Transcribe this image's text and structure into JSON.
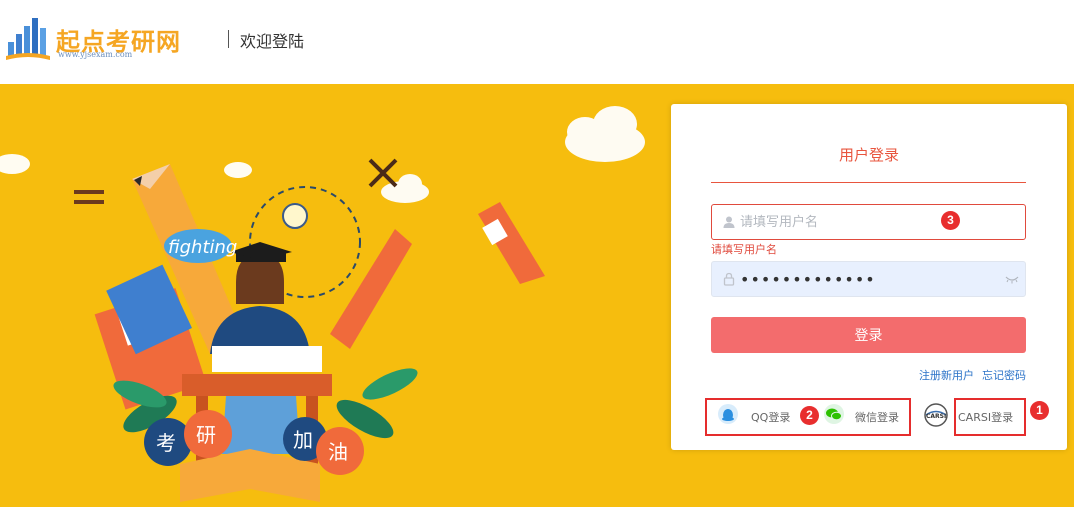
{
  "header": {
    "logo_text": "起点考研网",
    "logo_url": "www.yjsexam.com",
    "title": "欢迎登陆"
  },
  "illustration": {
    "fighting_text": "fighting",
    "chars": [
      "考",
      "研",
      "加",
      "油"
    ]
  },
  "login": {
    "title": "用户登录",
    "username_placeholder": "请填写用户名",
    "username_error": "请填写用户名",
    "password_value": "•••••••••••••",
    "submit_label": "登录",
    "register_link": "注册新用户",
    "forgot_link": "忘记密码",
    "qq_label": "QQ登录",
    "wechat_label": "微信登录",
    "carsi_label": "CARSI登录",
    "carsi_logo_text": "CARSI"
  },
  "annotations": {
    "badge_1": "1",
    "badge_2": "2",
    "badge_3": "3"
  },
  "colors": {
    "banner_bg": "#f6bd0e",
    "accent_red": "#e8553e",
    "button": "#f36c6d",
    "link": "#2b73c8"
  }
}
